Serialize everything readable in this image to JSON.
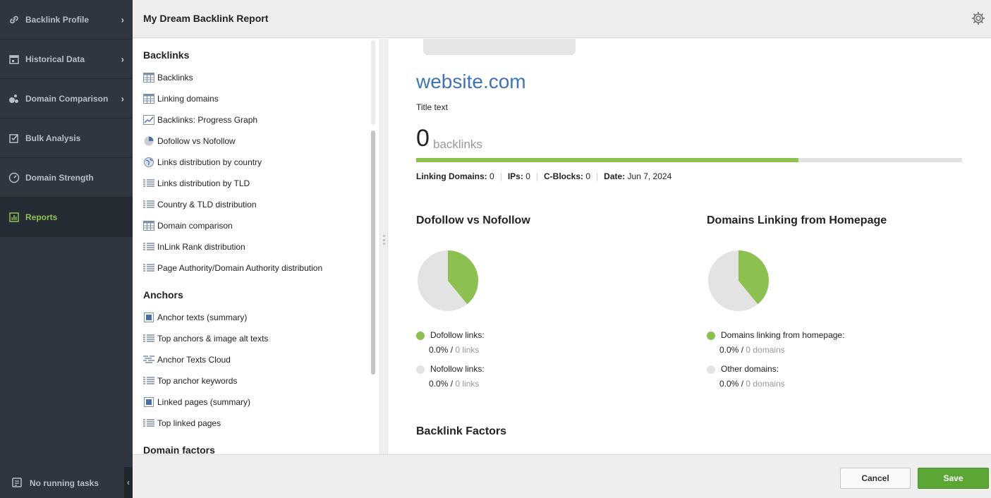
{
  "sidebar": {
    "items": [
      {
        "label": "Backlink Profile",
        "icon": "link-icon",
        "has_submenu": true
      },
      {
        "label": "Historical Data",
        "icon": "calendar-icon",
        "has_submenu": true
      },
      {
        "label": "Domain Comparison",
        "icon": "bubbles-icon",
        "has_submenu": true
      },
      {
        "label": "Bulk Analysis",
        "icon": "checklist-icon",
        "has_submenu": false
      },
      {
        "label": "Domain Strength",
        "icon": "gauge-icon",
        "has_submenu": false
      },
      {
        "label": "Reports",
        "icon": "report-icon",
        "has_submenu": false,
        "active": true
      }
    ],
    "tasks_label": "No running tasks"
  },
  "header": {
    "title": "My Dream Backlink Report"
  },
  "sections": [
    {
      "title": "Backlinks",
      "items": [
        {
          "label": "Backlinks",
          "icon": "table-icon"
        },
        {
          "label": "Linking domains",
          "icon": "table-icon"
        },
        {
          "label": "Backlinks: Progress Graph",
          "icon": "line-graph-icon"
        },
        {
          "label": "Dofollow vs Nofollow",
          "icon": "pie-icon"
        },
        {
          "label": "Links distribution by country",
          "icon": "globe-icon"
        },
        {
          "label": "Links distribution by TLD",
          "icon": "list-icon"
        },
        {
          "label": "Country & TLD distribution",
          "icon": "list-icon"
        },
        {
          "label": "Domain comparison",
          "icon": "table-icon"
        },
        {
          "label": "InLink Rank distribution",
          "icon": "list-icon"
        },
        {
          "label": "Page Authority/Domain Authority distribution",
          "icon": "list-icon"
        }
      ]
    },
    {
      "title": "Anchors",
      "items": [
        {
          "label": "Anchor texts (summary)",
          "icon": "summary-icon"
        },
        {
          "label": "Top anchors & image alt texts",
          "icon": "list-icon"
        },
        {
          "label": "Anchor Texts Cloud",
          "icon": "cloud-list-icon"
        },
        {
          "label": "Top anchor keywords",
          "icon": "list-icon"
        },
        {
          "label": "Linked pages (summary)",
          "icon": "summary-icon"
        },
        {
          "label": "Top linked pages",
          "icon": "list-icon"
        }
      ]
    },
    {
      "title": "Domain factors",
      "items": []
    }
  ],
  "preview": {
    "site": "website.com",
    "title_text": "Title text",
    "backlinks_count": "0",
    "backlinks_label": "backlinks",
    "progress_fraction": 0.7,
    "stats": {
      "linking_domains_label": "Linking Domains:",
      "linking_domains_value": "0",
      "ips_label": "IPs:",
      "ips_value": "0",
      "cblocks_label": "C-Blocks:",
      "cblocks_value": "0",
      "date_label": "Date:",
      "date_value": "Jun 7, 2024"
    },
    "charts": [
      {
        "title": "Dofollow vs Nofollow",
        "slice_fraction": 0.39,
        "legend": [
          {
            "label": "Dofollow links:",
            "pct": "0.0%",
            "sep": " / ",
            "count": "0 links",
            "color": "#8cc152"
          },
          {
            "label": "Nofollow links:",
            "pct": "0.0%",
            "sep": " / ",
            "count": "0 links",
            "color": "#e3e3e3"
          }
        ]
      },
      {
        "title": "Domains Linking from Homepage",
        "slice_fraction": 0.39,
        "legend": [
          {
            "label": "Domains linking from homepage:",
            "pct": "0.0%",
            "sep": " / ",
            "count": "0 domains",
            "color": "#8cc152"
          },
          {
            "label": "Other domains:",
            "pct": "0.0%",
            "sep": " / ",
            "count": "0 domains",
            "color": "#e3e3e3"
          }
        ]
      }
    ],
    "factors_title": "Backlink Factors"
  },
  "footer": {
    "cancel_label": "Cancel",
    "save_label": "Save"
  },
  "colors": {
    "accent": "#8cc152",
    "link": "#3e73b4",
    "save": "#5ba634",
    "nav_bg": "#2f3640"
  }
}
